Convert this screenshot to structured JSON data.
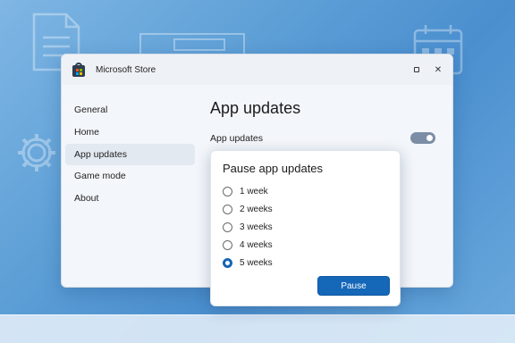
{
  "window": {
    "title": "Microsoft Store"
  },
  "sidebar": {
    "items": [
      {
        "label": "General"
      },
      {
        "label": "Home"
      },
      {
        "label": "App updates",
        "active": true
      },
      {
        "label": "Game mode"
      },
      {
        "label": "About"
      }
    ]
  },
  "main": {
    "page_title": "App updates",
    "setting_label": "App updates",
    "toggle_on": true
  },
  "dialog": {
    "title": "Pause app updates",
    "options": [
      {
        "label": "1 week",
        "checked": false
      },
      {
        "label": "2 weeks",
        "checked": false
      },
      {
        "label": "3 weeks",
        "checked": false
      },
      {
        "label": "4 weeks",
        "checked": false
      },
      {
        "label": "5 weeks",
        "checked": true
      }
    ],
    "button_label": "Pause"
  },
  "colors": {
    "accent": "#1567b8",
    "toggle": "#7c8ea6"
  },
  "icons": [
    "store-bag-icon",
    "maximize-icon",
    "close-icon",
    "document-icon",
    "calendar-icon",
    "gear-icon"
  ]
}
